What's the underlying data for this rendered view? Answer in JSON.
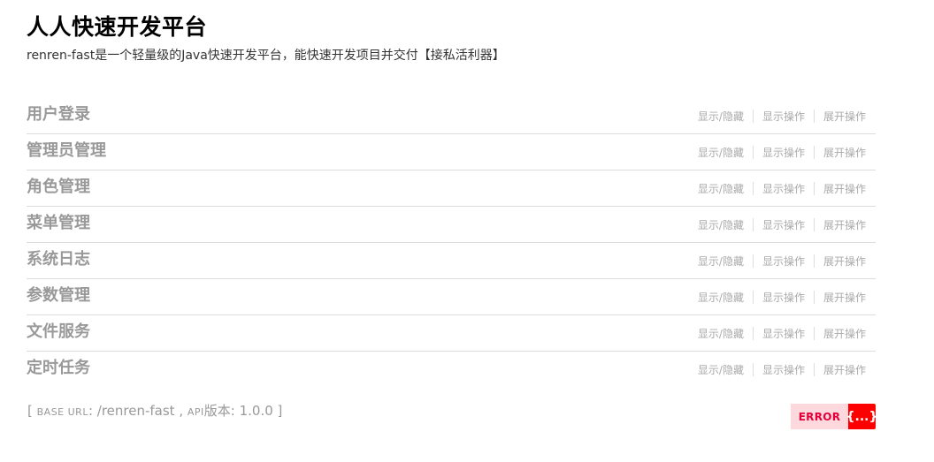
{
  "header": {
    "title": "人人快速开发平台",
    "description": "renren-fast是一个轻量级的Java快速开发平台，能快速开发项目并交付【接私活利器】"
  },
  "resources": [
    {
      "name": "用户登录",
      "toggle": "显示/隐藏",
      "list": "显示操作",
      "expand": "展开操作"
    },
    {
      "name": "管理员管理",
      "toggle": "显示/隐藏",
      "list": "显示操作",
      "expand": "展开操作"
    },
    {
      "name": "角色管理",
      "toggle": "显示/隐藏",
      "list": "显示操作",
      "expand": "展开操作"
    },
    {
      "name": "菜单管理",
      "toggle": "显示/隐藏",
      "list": "显示操作",
      "expand": "展开操作"
    },
    {
      "name": "系统日志",
      "toggle": "显示/隐藏",
      "list": "显示操作",
      "expand": "展开操作"
    },
    {
      "name": "参数管理",
      "toggle": "显示/隐藏",
      "list": "显示操作",
      "expand": "展开操作"
    },
    {
      "name": "文件服务",
      "toggle": "显示/隐藏",
      "list": "显示操作",
      "expand": "展开操作"
    },
    {
      "name": "定时任务",
      "toggle": "显示/隐藏",
      "list": "显示操作",
      "expand": "展开操作"
    }
  ],
  "footer": {
    "open_bracket": "[ ",
    "base_url_label": "BASE URL",
    "base_url_value": ": /renren-fast , ",
    "api_label": "API",
    "api_version_text": "版本: 1.0.0 ]"
  },
  "validator": {
    "label": "ERROR",
    "icon_text": "{...}",
    "icon_name": "validator-error-icon",
    "label_color": "#e3003b",
    "icon_bg_color": "#ff0000"
  }
}
